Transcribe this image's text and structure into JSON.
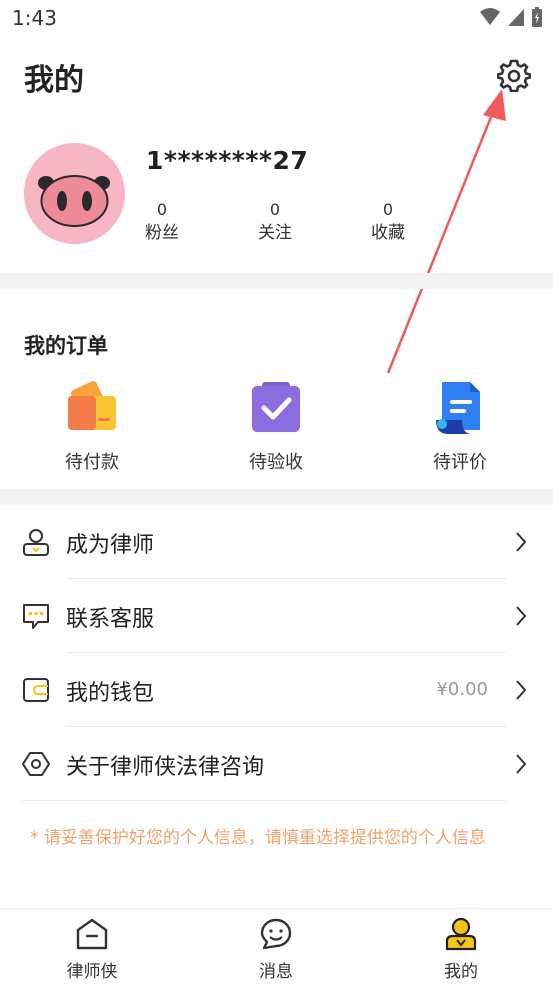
{
  "status": {
    "time": "1:43"
  },
  "header": {
    "title": "我的"
  },
  "profile": {
    "username": "1********27",
    "stats": [
      {
        "value": "0",
        "label": "粉丝"
      },
      {
        "value": "0",
        "label": "关注"
      },
      {
        "value": "0",
        "label": "收藏"
      }
    ]
  },
  "orders": {
    "title": "我的订单",
    "items": [
      {
        "label": "待付款",
        "icon": "wallet-card-icon"
      },
      {
        "label": "待验收",
        "icon": "check-box-icon"
      },
      {
        "label": "待评价",
        "icon": "document-icon"
      }
    ]
  },
  "menu": [
    {
      "label": "成为律师",
      "value": "",
      "icon": "lawyer-person-icon"
    },
    {
      "label": "联系客服",
      "value": "",
      "icon": "chat-dots-icon"
    },
    {
      "label": "我的钱包",
      "value": "¥0.00",
      "icon": "wallet-icon"
    },
    {
      "label": "关于律师侠法律咨询",
      "value": "",
      "icon": "hexagon-icon"
    }
  ],
  "notice": "* 请妥善保护好您的个人信息，请慎重选择提供您的个人信息",
  "tabs": [
    {
      "label": "律师侠",
      "icon": "home-icon"
    },
    {
      "label": "消息",
      "icon": "message-icon"
    },
    {
      "label": "我的",
      "icon": "profile-icon",
      "active": true
    }
  ],
  "colors": {
    "accent": "#f5c518",
    "notice": "#f0a36a",
    "annotation_arrow": "#f05a5a"
  }
}
